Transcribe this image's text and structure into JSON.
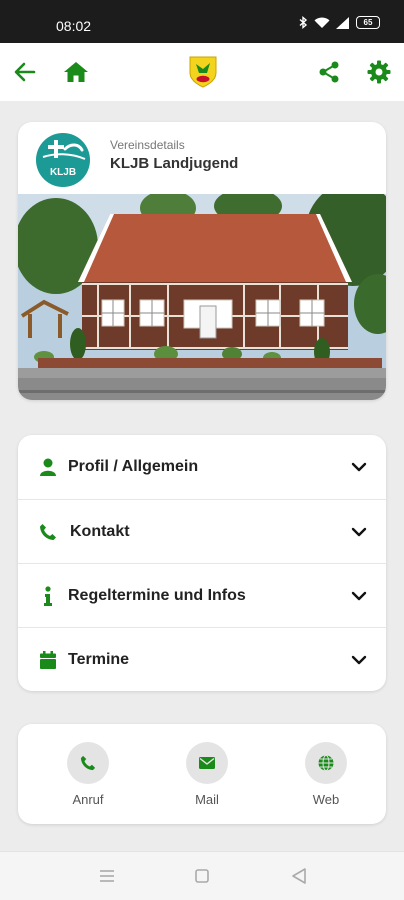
{
  "status_bar": {
    "time": "08:02",
    "battery": "65"
  },
  "app_bar": {
    "accent": "#1a8a1a"
  },
  "club": {
    "subtitle": "Vereinsdetails",
    "title": "KLJB Landjugend",
    "logo_text": "KLJB"
  },
  "menu": {
    "items": [
      {
        "label": "Profil / Allgemein",
        "icon": "person-icon"
      },
      {
        "label": "Kontakt",
        "icon": "phone-icon"
      },
      {
        "label": "Regeltermine und Infos",
        "icon": "info-icon"
      },
      {
        "label": "Termine",
        "icon": "calendar-icon"
      }
    ]
  },
  "contact": {
    "actions": [
      {
        "label": "Anruf",
        "icon": "phone-icon"
      },
      {
        "label": "Mail",
        "icon": "mail-icon"
      },
      {
        "label": "Web",
        "icon": "globe-icon"
      }
    ]
  }
}
